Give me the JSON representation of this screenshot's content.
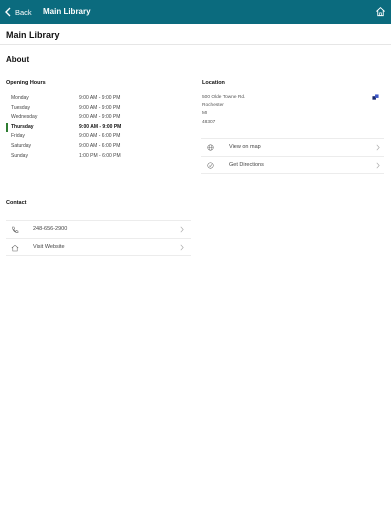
{
  "navbar": {
    "back_label": "Back",
    "title": "Main Library",
    "back_icon": "chevron-left-icon",
    "home_icon": "home-icon",
    "color": "#0b6b7e"
  },
  "page": {
    "title": "Main Library",
    "section": "About"
  },
  "hours": {
    "heading": "Opening Hours",
    "today_color": "#2e7d32",
    "rows": [
      {
        "day": "Monday",
        "time": "9:00 AM - 9:00 PM"
      },
      {
        "day": "Tuesday",
        "time": "9:00 AM - 9:00 PM"
      },
      {
        "day": "Wednesday",
        "time": "9:00 AM - 9:00 PM"
      },
      {
        "day": "Thursday",
        "time": "9:00 AM - 9:00 PM",
        "today": true
      },
      {
        "day": "Friday",
        "time": "9:00 AM - 6:00 PM"
      },
      {
        "day": "Saturday",
        "time": "9:00 AM - 6:00 PM"
      },
      {
        "day": "Sunday",
        "time": "1:00 PM - 6:00 PM"
      }
    ]
  },
  "location": {
    "heading": "Location",
    "address": [
      "500 Olde Towne Rd.",
      "Rochester",
      "MI",
      "48307"
    ],
    "icon": "location-icon",
    "actions": [
      {
        "label": "View on map",
        "icon": "globe-icon"
      },
      {
        "label": "Get Directions",
        "icon": "directions-icon"
      }
    ]
  },
  "contact": {
    "heading": "Contact",
    "items": [
      {
        "label": "248-656-2900",
        "icon": "phone-icon"
      },
      {
        "label": "Visit Website",
        "icon": "home-icon"
      }
    ]
  }
}
